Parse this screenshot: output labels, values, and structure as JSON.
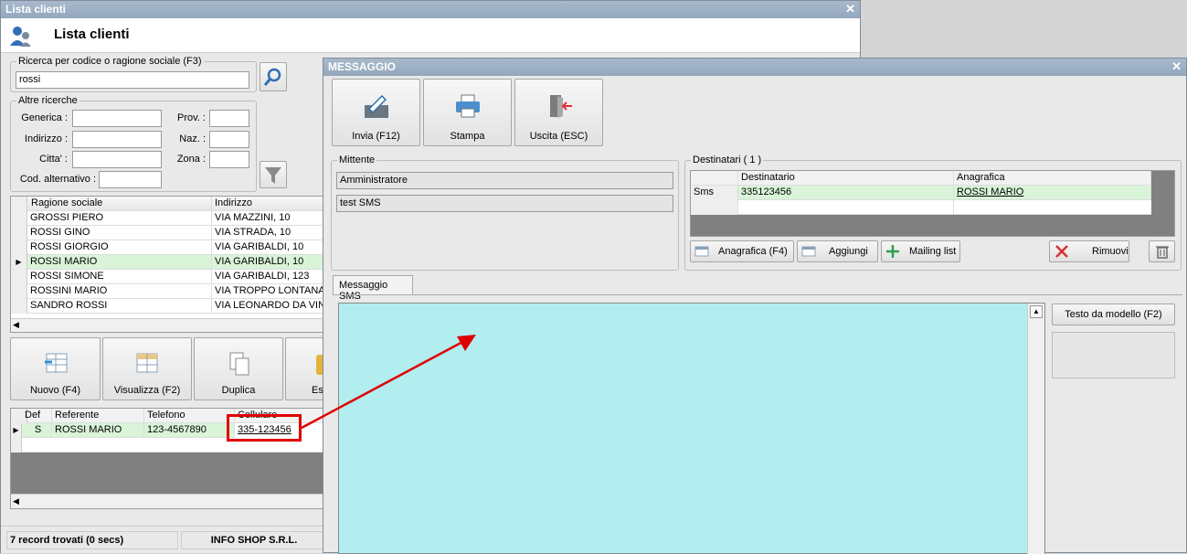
{
  "lista": {
    "title": "Lista clienti",
    "header": "Lista clienti",
    "search_group": "Ricerca per codice o ragione sociale (F3)",
    "search_value": "rossi",
    "altre": "Altre ricerche",
    "generica": "Generica :",
    "indirizzo": "Indirizzo :",
    "citta": "Citta' :",
    "cod_alt": "Cod. alternativo :",
    "prov": "Prov. :",
    "naz": "Naz. :",
    "zona": "Zona :",
    "cols": [
      "Ragione sociale",
      "Indirizzo"
    ],
    "rows": [
      {
        "name": "GROSSI PIERO",
        "addr": "VIA MAZZINI, 10"
      },
      {
        "name": "ROSSI GINO",
        "addr": "VIA STRADA, 10"
      },
      {
        "name": "ROSSI GIORGIO",
        "addr": "VIA GARIBALDI, 10"
      },
      {
        "name": "ROSSI MARIO",
        "addr": "VIA GARIBALDI, 10"
      },
      {
        "name": "ROSSI SIMONE",
        "addr": "VIA GARIBALDI, 123"
      },
      {
        "name": "ROSSINI MARIO",
        "addr": "VIA TROPPO LONTANA ..."
      },
      {
        "name": "SANDRO ROSSI",
        "addr": "VIA LEONARDO DA VIN..."
      }
    ],
    "buttons": [
      "Nuovo (F4)",
      "Visualizza (F2)",
      "Duplica",
      "Es"
    ],
    "ref_cols": [
      "Def",
      "Referente",
      "Telefono",
      "Cellulare"
    ],
    "ref_row": {
      "def": "S",
      "name": "ROSSI MARIO",
      "tel": "123-4567890",
      "cell": "335-123456"
    },
    "status": "7 record trovati (0 secs)",
    "company": "INFO SHOP S.R.L."
  },
  "messaggio": {
    "title": "MESSAGGIO",
    "buttons": [
      "Invia (F12)",
      "Stampa",
      "Uscita (ESC)"
    ],
    "mittente": "Mittente",
    "mittente_name": "Amministratore",
    "subject": "test SMS",
    "destinatari": "Destinatari ( 1 )",
    "dest_cols": [
      "Destinatario",
      "Anagrafica"
    ],
    "dest_row": {
      "type": "Sms",
      "num": "335123456",
      "ana": "ROSSI MARIO"
    },
    "dest_buttons": [
      "Anagrafica (F4)",
      "Aggiungi",
      "Mailing list",
      "Rimuovi"
    ],
    "tab": "Messaggio SMS",
    "modello": "Testo da modello (F2)",
    "colors": {
      "message_bg": "#b2eef0",
      "highlight": "#e00000",
      "selected_row": "#d9f4d9"
    }
  }
}
